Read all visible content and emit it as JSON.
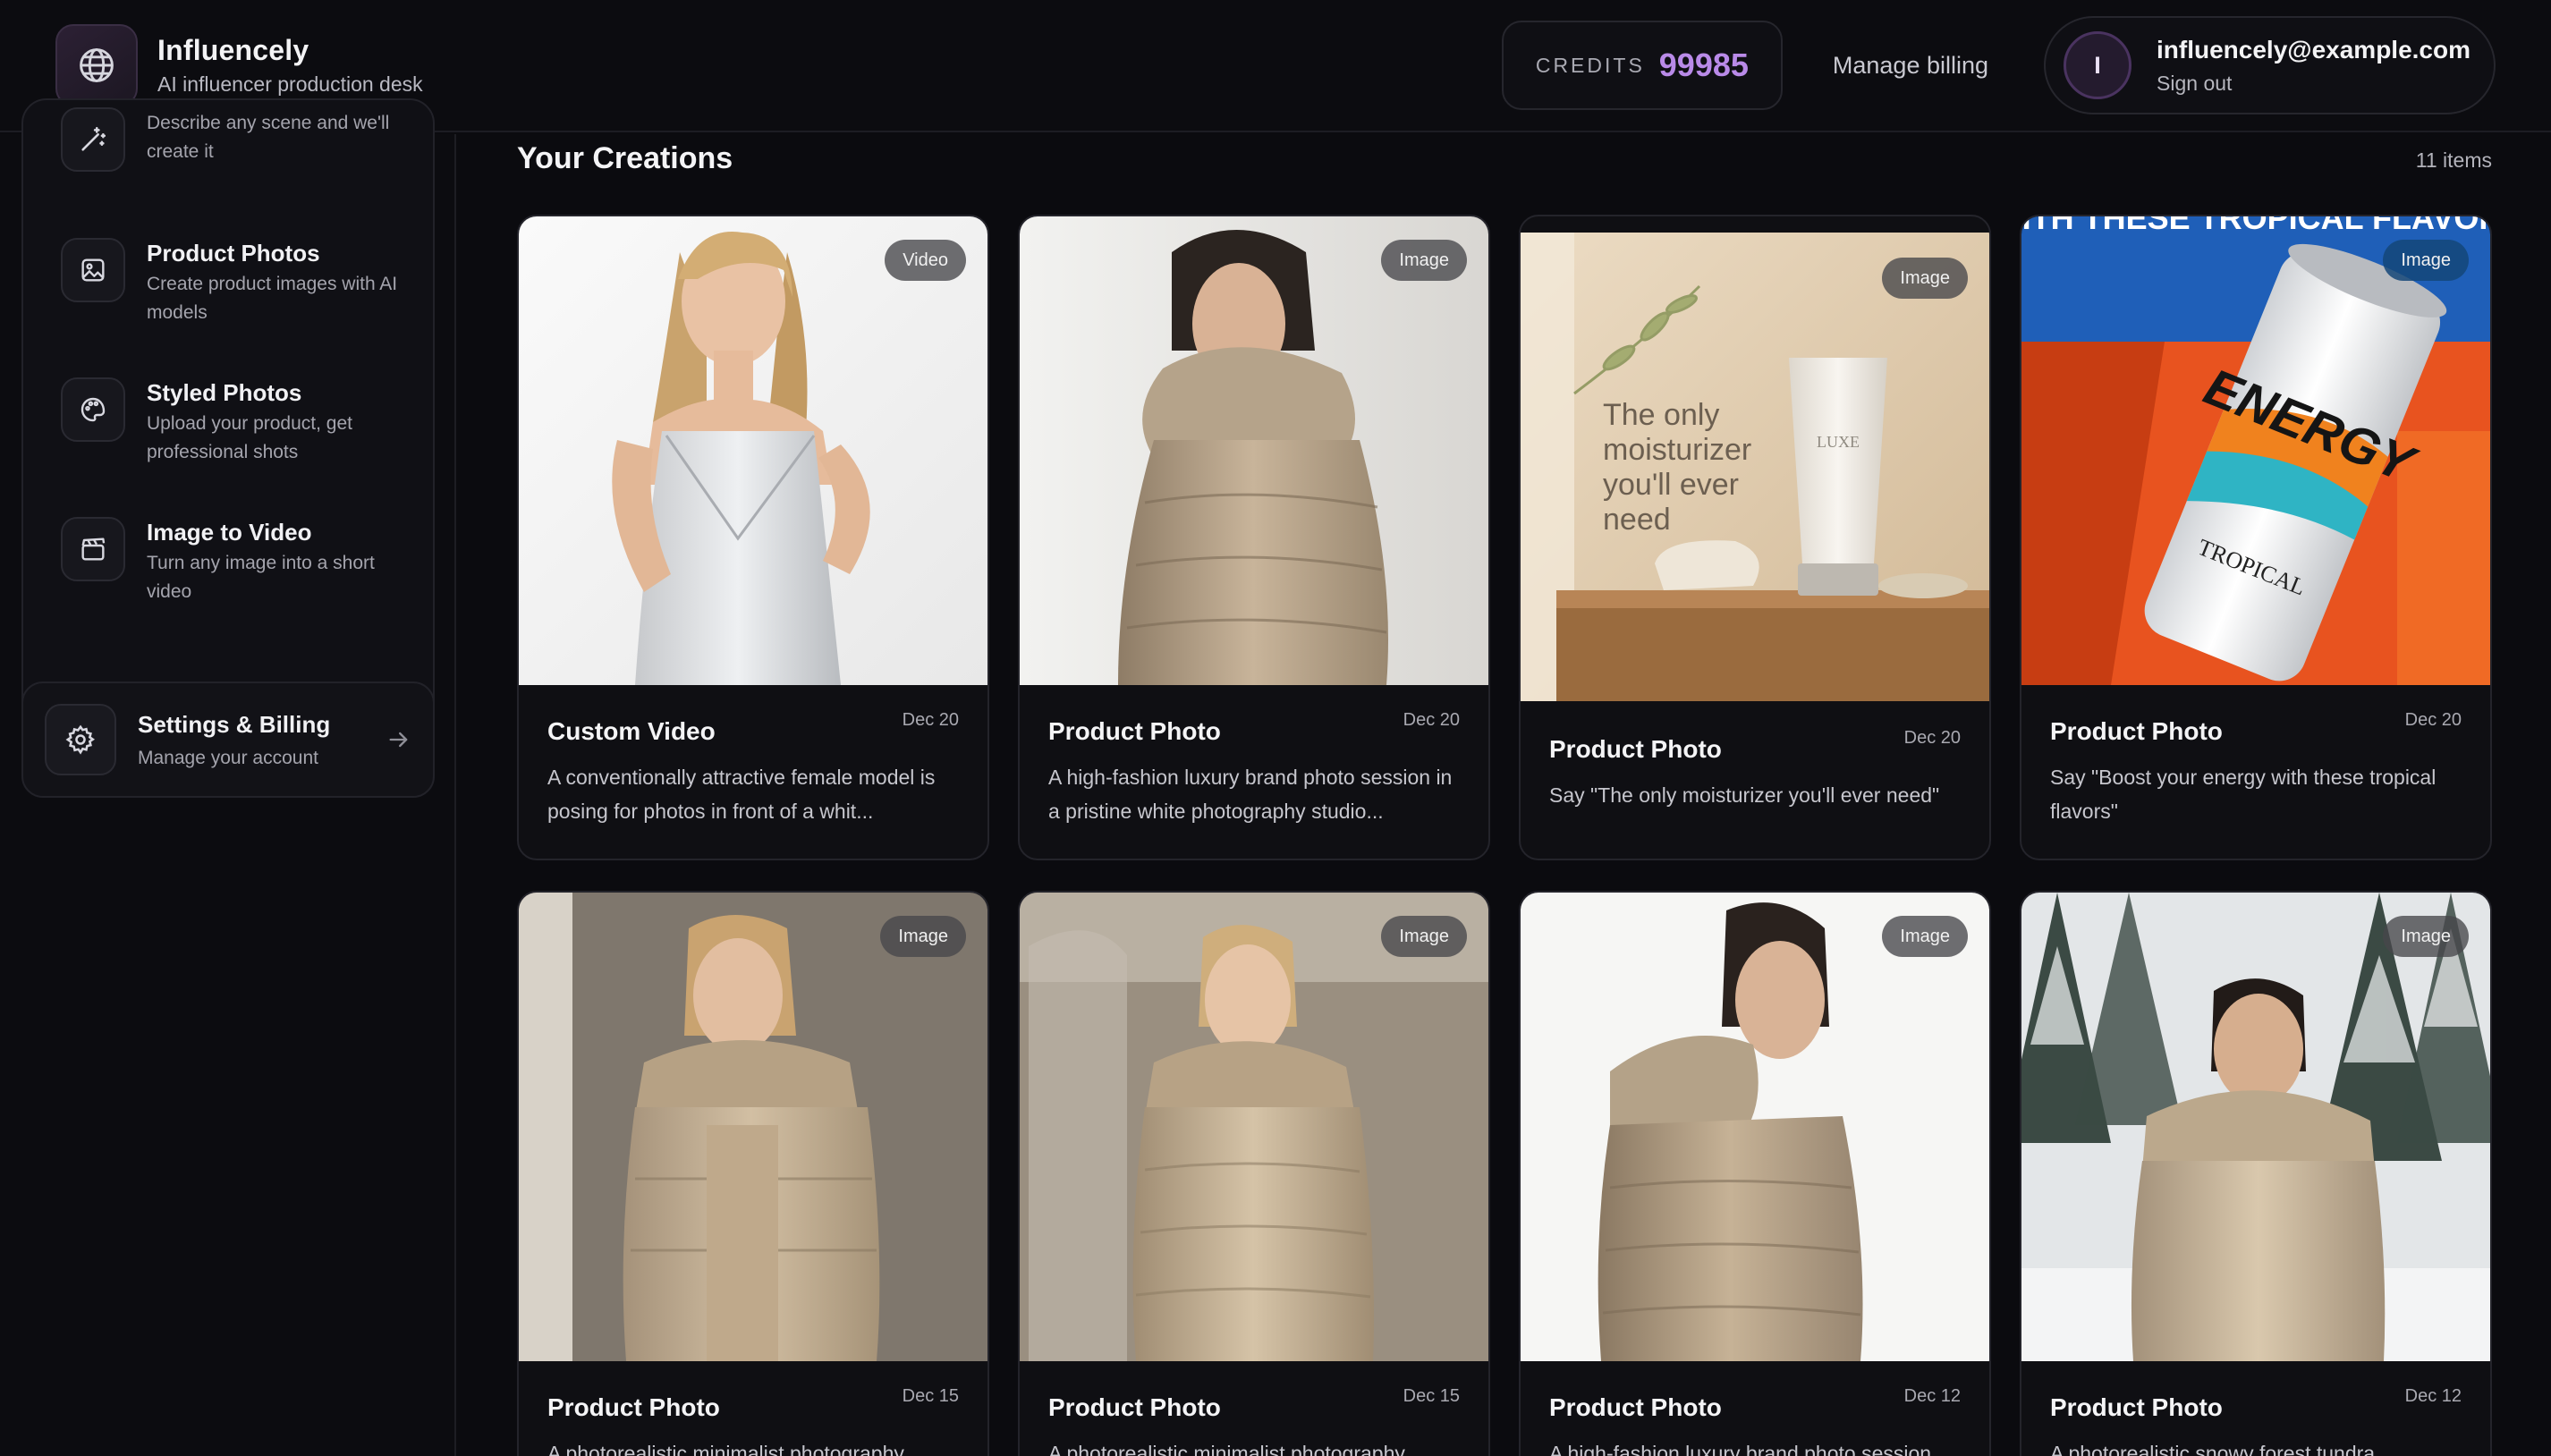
{
  "header": {
    "brand_name": "Influencely",
    "brand_tagline": "AI influencer production desk",
    "credits_label": "CREDITS",
    "credits_value": "99985",
    "manage_billing": "Manage billing",
    "avatar_initial": "I",
    "user_email": "influencely@example.com",
    "sign_out": "Sign out",
    "accent_color": "#b98ae8"
  },
  "sidebar": {
    "tools": [
      {
        "title": "",
        "desc": "Describe any scene and we'll create it",
        "icon": "magic-wand-icon"
      },
      {
        "title": "Product Photos",
        "desc": "Create product images with AI models",
        "icon": "image-icon"
      },
      {
        "title": "Styled Photos",
        "desc": "Upload your product, get professional shots",
        "icon": "palette-icon"
      },
      {
        "title": "Image to Video",
        "desc": "Turn any image into a short video",
        "icon": "clapperboard-icon"
      }
    ],
    "settings": {
      "title": "Settings & Billing",
      "subtitle": "Manage your account",
      "icon": "gear-icon"
    }
  },
  "main": {
    "title": "Your Creations",
    "count": "11 items",
    "cards": [
      {
        "badge": "Video",
        "title": "Custom Video",
        "date": "Dec 20",
        "desc": "A conventionally attractive female model is posing for photos in front of a whit..."
      },
      {
        "badge": "Image",
        "title": "Product Photo",
        "date": "Dec 20",
        "desc": "A high-fashion luxury brand photo session in a pristine white photography studio..."
      },
      {
        "badge": "Image",
        "title": "Product Photo",
        "date": "Dec 20",
        "desc": "Say \"The only moisturizer you'll ever need\"",
        "overlay_text": [
          "The only",
          "moisturizer",
          "you'll ever",
          "need"
        ],
        "product_brand": "LUXE"
      },
      {
        "badge": "Image",
        "title": "Product Photo",
        "date": "Dec 20",
        "desc": "Say \"Boost your energy with these tropical flavors\"",
        "overlay_banner": "WITH THESE TROPICAL FLAVORS",
        "can_text": "ENERGY",
        "can_sub": "TROPICAL"
      },
      {
        "badge": "Image",
        "title": "Product Photo",
        "date": "Dec 15",
        "desc": "A photorealistic minimalist photography"
      },
      {
        "badge": "Image",
        "title": "Product Photo",
        "date": "Dec 15",
        "desc": "A photorealistic minimalist photography"
      },
      {
        "badge": "Image",
        "title": "Product Photo",
        "date": "Dec 12",
        "desc": "A high-fashion luxury brand photo session"
      },
      {
        "badge": "Image",
        "title": "Product Photo",
        "date": "Dec 12",
        "desc": "A photorealistic snowy forest tundra"
      }
    ]
  }
}
